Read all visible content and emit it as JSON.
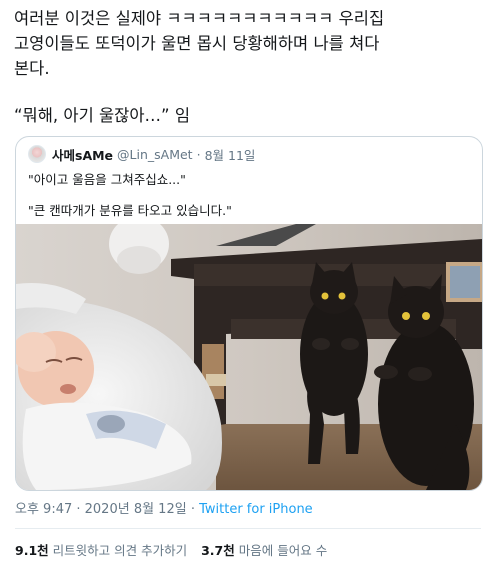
{
  "tweet": {
    "text_line1": "여러분 이것은 실제야 ㅋㅋㅋㅋㅋㅋㅋㅋㅋㅋㅋ 우리집",
    "text_line2": "고영이들도 또덕이가 울면 몹시 당황해하며 나를 쳐다",
    "text_line3": "본다.",
    "text_line4": "“뭐해, 아기 울잖아…” 임"
  },
  "quoted": {
    "name": "사메sAMe",
    "handle": "@Lin_sAMet",
    "separator": "·",
    "date": "8월 11일",
    "line1": "\"아이고 울음을 그쳐주십쇼...\"",
    "line2": "\"큰 캔따개가 분유를 타오고 있습니다.\"",
    "photo_icon": "baby-and-two-black-cats-photo"
  },
  "footer": {
    "time": "오후 9:47 · 2020년 8월 12일 · ",
    "app": "Twitter for iPhone"
  },
  "stats": {
    "retweet_count": "9.1천",
    "retweet_label": "리트윗하고 의견 추가하기",
    "like_count": "3.7천",
    "like_label": "마음에 들어요 수"
  },
  "colors": {
    "text": "#14171a",
    "muted": "#657786",
    "link": "#1da1f2",
    "border": "#ccd6dd"
  }
}
